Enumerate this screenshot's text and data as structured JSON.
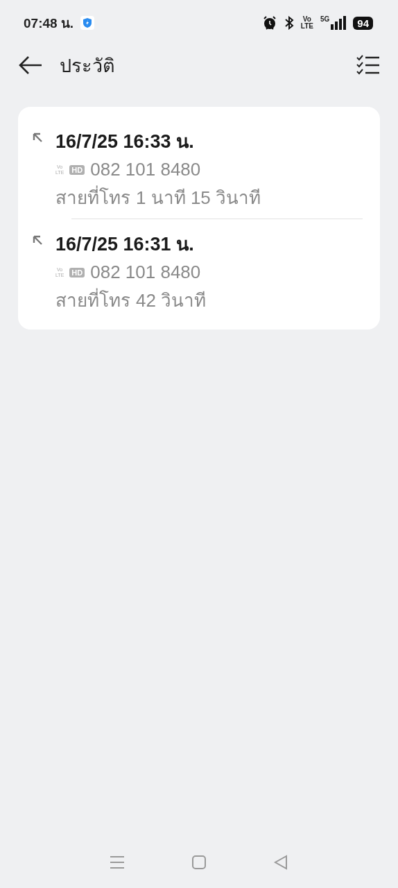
{
  "status_bar": {
    "time": "07:48 น.",
    "volte": [
      "Vo",
      "LTE"
    ],
    "network": "5G",
    "battery": "94"
  },
  "header": {
    "title": "ประวัติ"
  },
  "calls": [
    {
      "datetime": "16/7/25 16:33 น.",
      "volte": [
        "Vo",
        "LTE"
      ],
      "hd": "HD",
      "number": "082 101 8480",
      "label": "สายที่โทร",
      "duration": "1 นาที 15 วินาที"
    },
    {
      "datetime": "16/7/25 16:31 น.",
      "volte": [
        "Vo",
        "LTE"
      ],
      "hd": "HD",
      "number": "082 101 8480",
      "label": "สายที่โทร",
      "duration": "42 วินาที"
    }
  ]
}
